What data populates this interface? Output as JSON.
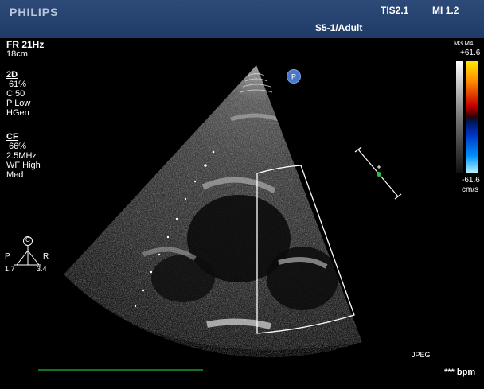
{
  "header": {
    "brand": "PHILIPS",
    "tis": "TIS2.1",
    "mi": "MI 1.2",
    "probe_preset": "S5-1/Adult"
  },
  "acquisition": {
    "frame_rate": "FR 21Hz",
    "depth": "18cm"
  },
  "mode_2d": {
    "label": "2D",
    "gain": "61%",
    "compress": "C 50",
    "power": "P Low",
    "freq": "HGen"
  },
  "mode_cf": {
    "label": "CF",
    "gain": "66%",
    "freq": "2.5MHz",
    "filter": "WF High",
    "velocity": "Med"
  },
  "color_scale": {
    "map": "M3 M4",
    "max": "+61.6",
    "min": "-61.6",
    "unit": "cm/s"
  },
  "orientation": {
    "center_marker": "C",
    "left": "P",
    "right": "R",
    "left_value": "1.7",
    "right_value": "3.4"
  },
  "marker_p": "P",
  "footer": {
    "format": "JPEG",
    "heart_rate": "*** bpm"
  },
  "colors": {
    "topbar": "#1f3a66",
    "roi_box": "#ffffff",
    "ecg_line": "#1db33a",
    "focus_dot": "#2bbd4a"
  }
}
